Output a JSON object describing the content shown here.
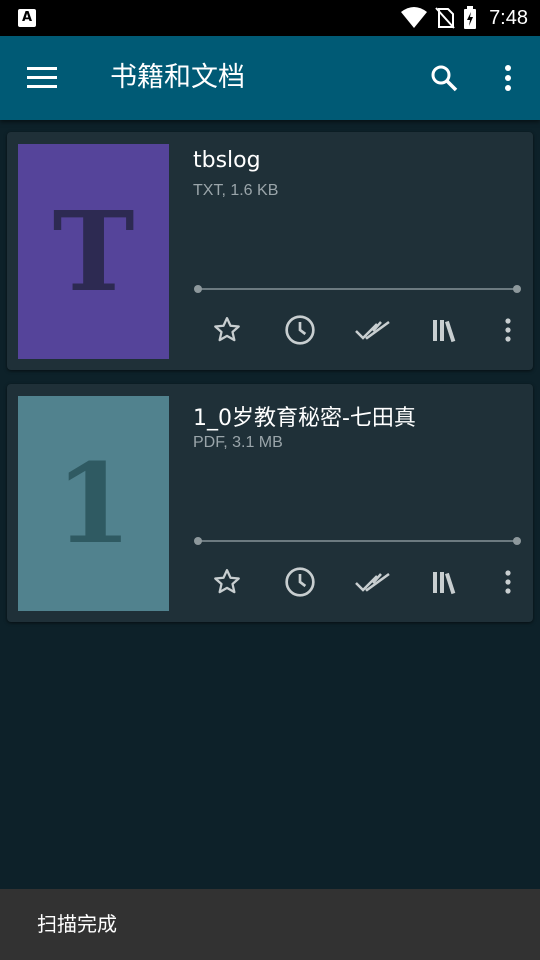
{
  "status_bar": {
    "time": "7:48",
    "app_indicator": "A"
  },
  "toolbar": {
    "title": "书籍和文档"
  },
  "books": [
    {
      "title": "tbslog",
      "meta": "TXT, 1.6 KB",
      "cover_letter": "T",
      "cover_color": "#55449a",
      "glyph_color": "#2d2a52"
    },
    {
      "title": "1_0岁教育秘密-七田真",
      "meta": "PDF, 3.1 MB",
      "cover_letter": "1",
      "cover_color": "#51828e",
      "glyph_color": "#2f5a62"
    }
  ],
  "snackbar": {
    "message": "扫描完成"
  },
  "colors": {
    "toolbar": "#005a75",
    "background": "#0d2129",
    "card": "#1f3038"
  }
}
